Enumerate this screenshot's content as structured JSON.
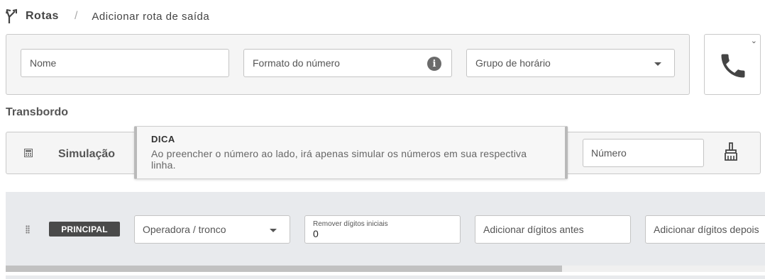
{
  "breadcrumb": {
    "root": "Rotas",
    "separator": "/",
    "current": "Adicionar rota de saída",
    "icon": "route-split-icon"
  },
  "form": {
    "name_placeholder": "Nome",
    "number_format_placeholder": "Formato do número",
    "number_format_info_icon": "info-icon",
    "schedule_group_placeholder": "Grupo de horário",
    "phone_icon": "phone-icon",
    "phone_dropdown_icon": "chevron-down-icon"
  },
  "overflow": {
    "title": "Transbordo"
  },
  "simulation": {
    "label": "Simulação",
    "icon": "calculator-icon",
    "number_placeholder": "Número",
    "clear_icon": "broom-icon"
  },
  "tooltip": {
    "title": "DICA",
    "body": "Ao preencher o número ao lado, irá apenas simular os números em sua respectiva linha."
  },
  "route_row": {
    "badge": "PRINCIPAL",
    "carrier_placeholder": "Operadora / tronco",
    "remove_digits_label": "Remover dígitos iniciais",
    "remove_digits_value": "0",
    "add_before_placeholder": "Adicionar dígitos antes",
    "add_after_placeholder": "Adicionar dígitos depois"
  },
  "scroll": {
    "horizontal_position": 0
  }
}
